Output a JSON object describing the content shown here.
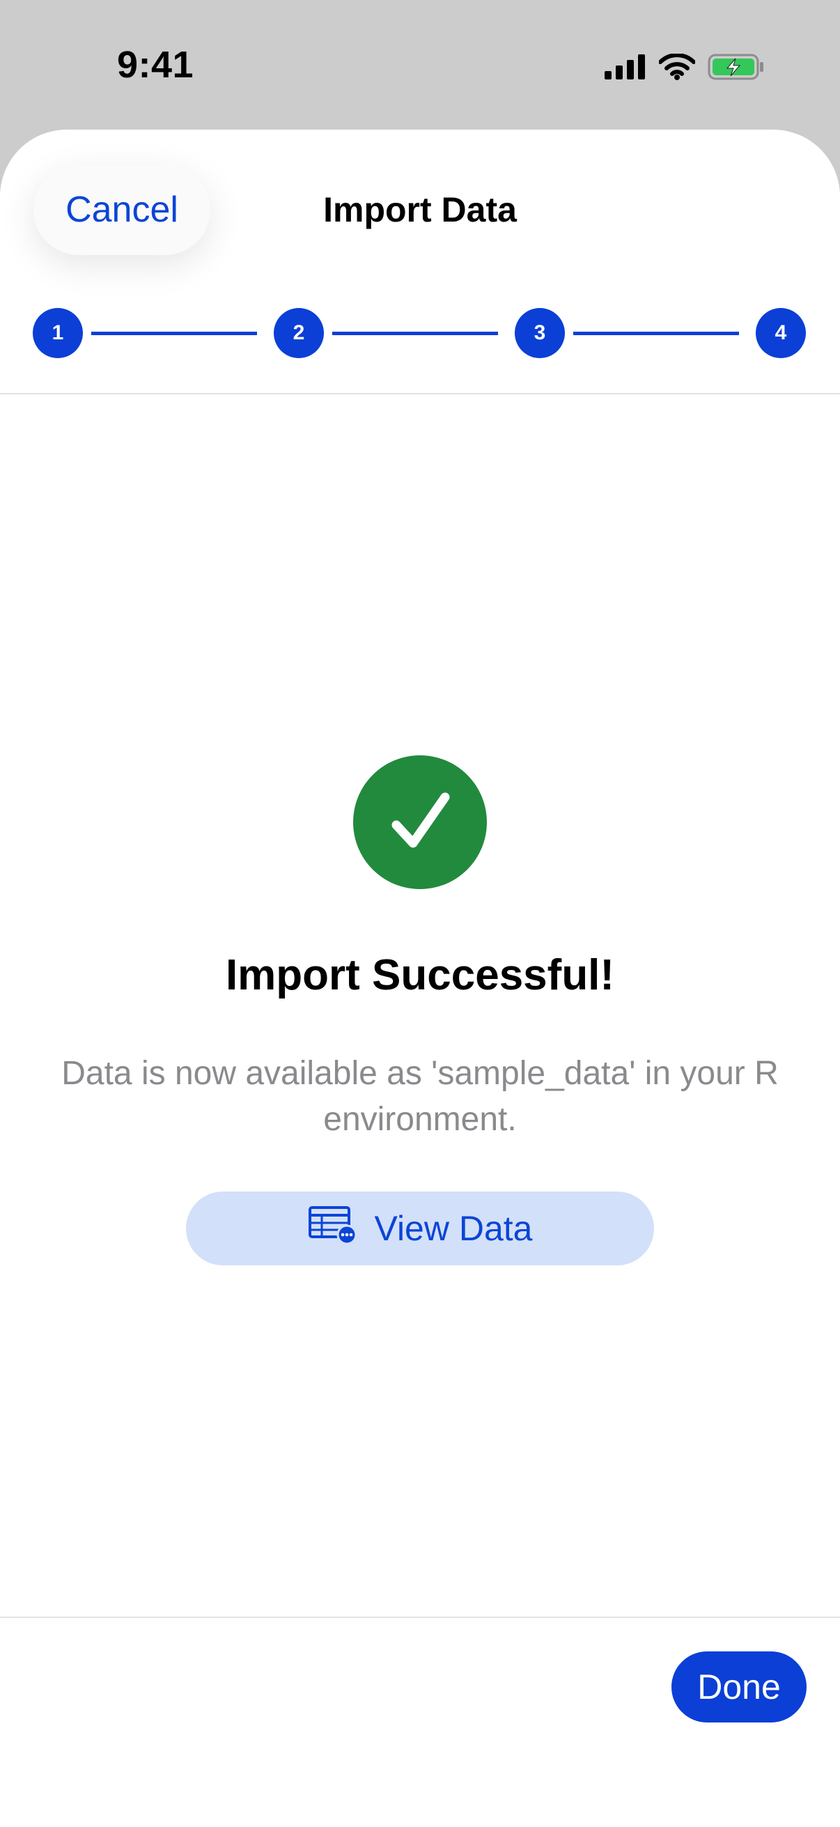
{
  "status_bar": {
    "time": "9:41",
    "icons": [
      "cellular-signal-icon",
      "wifi-icon",
      "battery-charging-icon"
    ]
  },
  "header": {
    "cancel_label": "Cancel",
    "title": "Import Data"
  },
  "stepper": {
    "steps": [
      "1",
      "2",
      "3",
      "4"
    ],
    "current_step": 4,
    "accent": "#0b3fd6"
  },
  "result": {
    "icon": "checkmark-circle-icon",
    "title": "Import Successful!",
    "message": "Data is now available as 'sample_data' in your R environment.",
    "view_button_label": "View Data",
    "view_button_icon": "table-icon"
  },
  "footer": {
    "done_label": "Done"
  },
  "colors": {
    "success": "#228a3d",
    "accent": "#0b3fd6",
    "accent_light": "#d3e0f9",
    "secondary_text": "#8a8a8e"
  }
}
